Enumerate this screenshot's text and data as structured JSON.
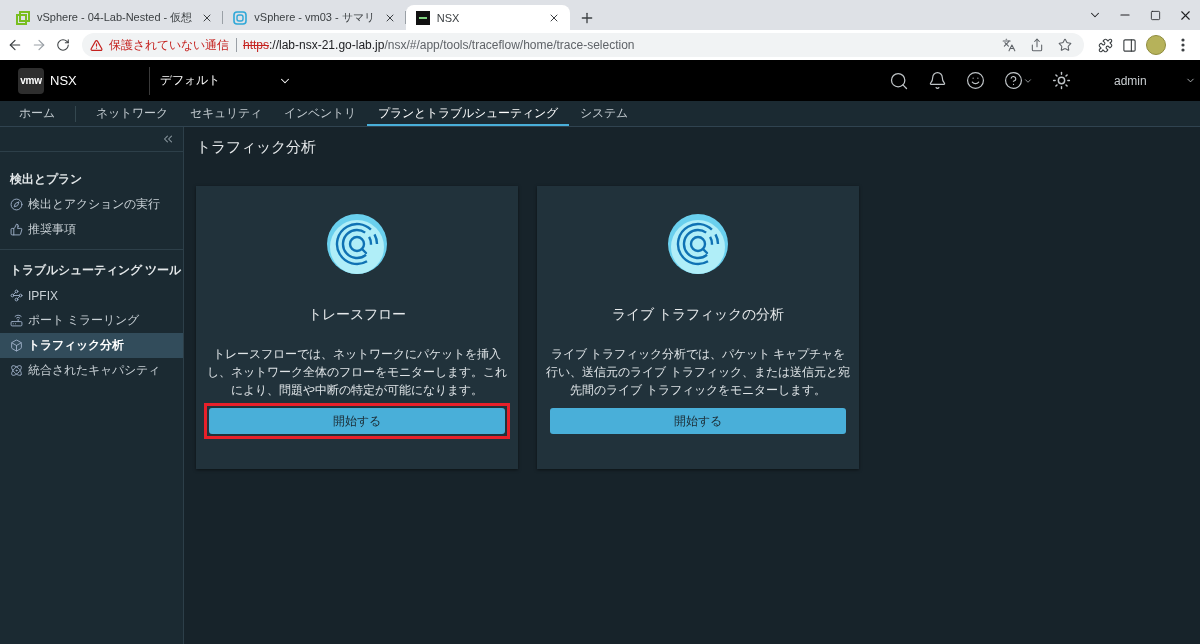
{
  "browser": {
    "tabs": [
      {
        "title": "vSphere - 04-Lab-Nested - 仮想",
        "selected": false
      },
      {
        "title": "vSphere - vm03 - サマリ",
        "selected": false
      },
      {
        "title": "NSX",
        "selected": true
      }
    ],
    "address": {
      "warning": "保護されていない通信",
      "scheme": "https",
      "host": "://lab-nsx-21.go-lab.jp",
      "path": "/nsx/#/app/tools/traceflow/home/trace-selection"
    }
  },
  "header": {
    "logo": "vmw",
    "product": "NSX",
    "project": "デフォルト",
    "user": "admin"
  },
  "nav": [
    {
      "label": "ホーム",
      "selected": false
    },
    {
      "label": "ネットワーク",
      "selected": false
    },
    {
      "label": "セキュリティ",
      "selected": false
    },
    {
      "label": "インベントリ",
      "selected": false
    },
    {
      "label": "プランとトラブルシューティング",
      "selected": true
    },
    {
      "label": "システム",
      "selected": false
    }
  ],
  "sidebar": {
    "sections": [
      {
        "heading": "検出とプラン",
        "items": [
          {
            "label": "検出とアクションの実行",
            "selected": false
          },
          {
            "label": "推奨事項",
            "selected": false
          }
        ]
      },
      {
        "heading": "トラブルシューティング ツール",
        "items": [
          {
            "label": "IPFIX",
            "selected": false
          },
          {
            "label": "ポート ミラーリング",
            "selected": false
          },
          {
            "label": "トラフィック分析",
            "selected": true
          },
          {
            "label": "統合されたキャパシティ",
            "selected": false
          }
        ]
      }
    ]
  },
  "page": {
    "title": "トラフィック分析",
    "cards": [
      {
        "title": "トレースフロー",
        "description": "トレースフローでは、ネットワークにパケットを挿入し、ネットワーク全体のフローをモニターします。これにより、問題や中断の特定が可能になります。",
        "button": "開始する",
        "highlighted": true
      },
      {
        "title": "ライブ トラフィックの分析",
        "description": "ライブ トラフィック分析では、パケット キャプチャを行い、送信元のライブ トラフィック、または送信元と宛先間のライブ トラフィックをモニターします。",
        "button": "開始する",
        "highlighted": false
      }
    ]
  }
}
